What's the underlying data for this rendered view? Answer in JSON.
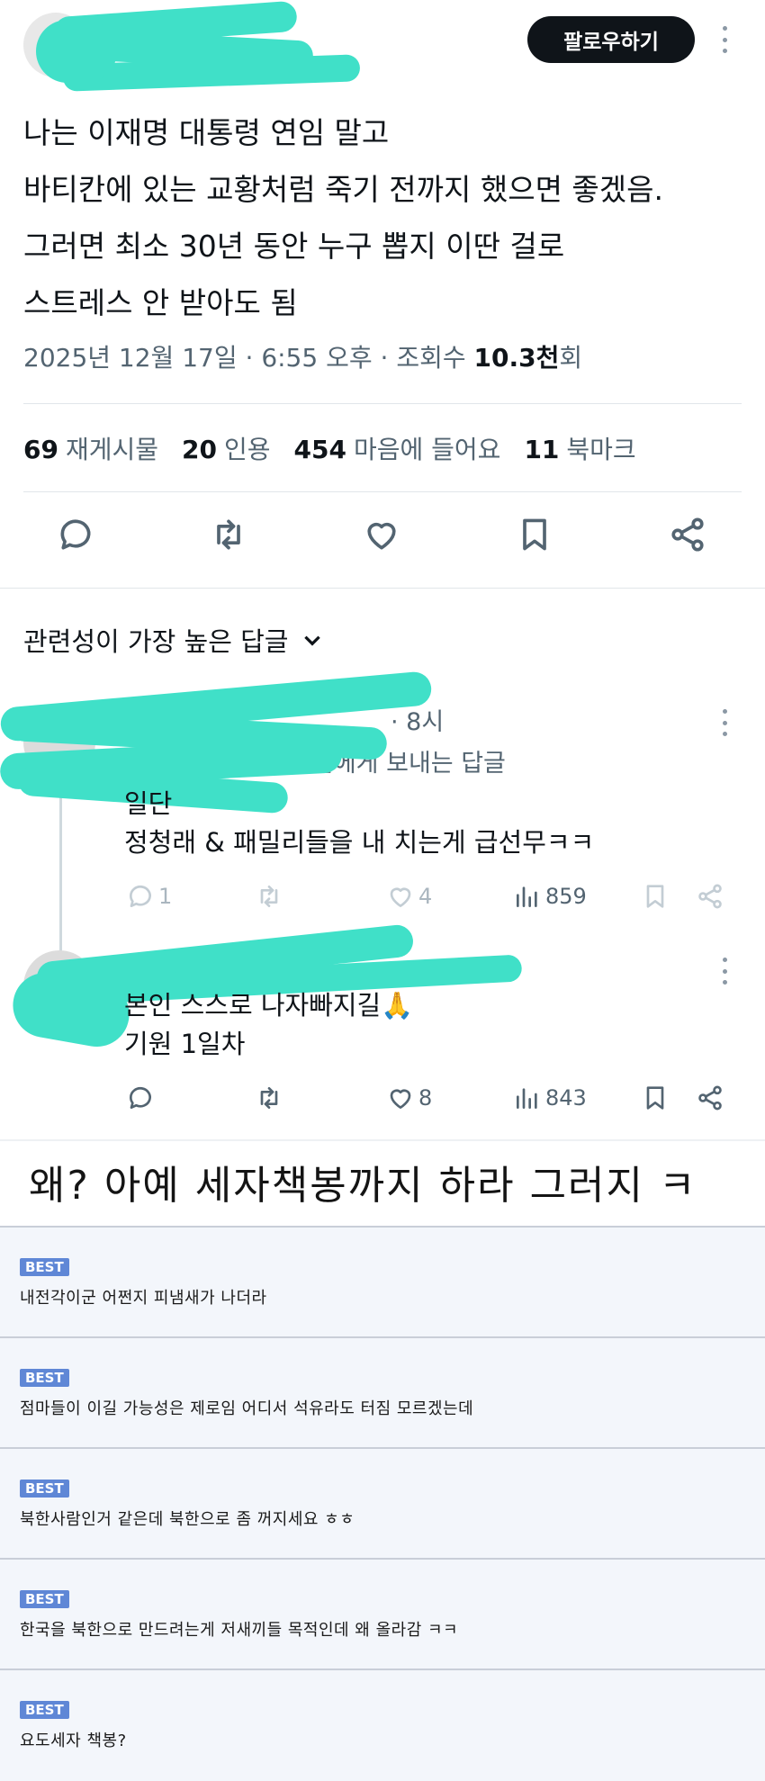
{
  "tweet": {
    "follow_label": "팔로우하기",
    "lines": [
      "나는 이재명 대통령 연임 말고",
      "바티칸에 있는 교황처럼 죽기 전까지 했으면 좋겠음.",
      "그러면 최소 30년 동안 누구 뽑지 이딴 걸로",
      "스트레스 안 받아도 됨"
    ],
    "meta": {
      "date": "2025년 12월 17일",
      "sep1": " · ",
      "time": "6:55 오후",
      "sep2": " · ",
      "views_label": "조회수 ",
      "views_value": "10.3천",
      "views_suffix": "회"
    },
    "stats": [
      {
        "value": "69",
        "label": "재게시물"
      },
      {
        "value": "20",
        "label": "인용"
      },
      {
        "value": "454",
        "label": "마음에 들어요"
      },
      {
        "value": "11",
        "label": "북마크"
      }
    ]
  },
  "sort_label": "관련성이 가장 높은 답글",
  "replies": [
    {
      "time": "· 8시",
      "reply_to": "님에게 보내는 답글",
      "lines": [
        "일단",
        "정청래 & 패밀리들을 내 치는게 급선무ㅋㅋ"
      ],
      "replies": "1",
      "retweets": "",
      "likes": "4",
      "views": "859"
    },
    {
      "lines": [
        "본인 스스로 나자빠지길🙏",
        "기원 1일차"
      ],
      "replies": "",
      "retweets": "",
      "likes": "8",
      "views": "843"
    }
  ],
  "caption": "왜? 아예 세자책봉까지 하라 그러지 ㅋ",
  "comments": {
    "badge": "BEST",
    "items": [
      "내전각이군 어쩐지 피냄새가 나더라",
      "점마들이 이길 가능성은 제로임 어디서 석유라도 터짐 모르겠는데",
      "북한사람인거 같은데 북한으로 좀 꺼지세요 ㅎㅎ",
      "한국을 북한으로 만드려는게 저새끼들 목적인데 왜 올라감 ㅋㅋ",
      "요도세자 책봉?"
    ]
  },
  "colors": {
    "censor": "#40e0c8",
    "best_badge": "#5f87d6",
    "text_secondary": "#536471"
  }
}
